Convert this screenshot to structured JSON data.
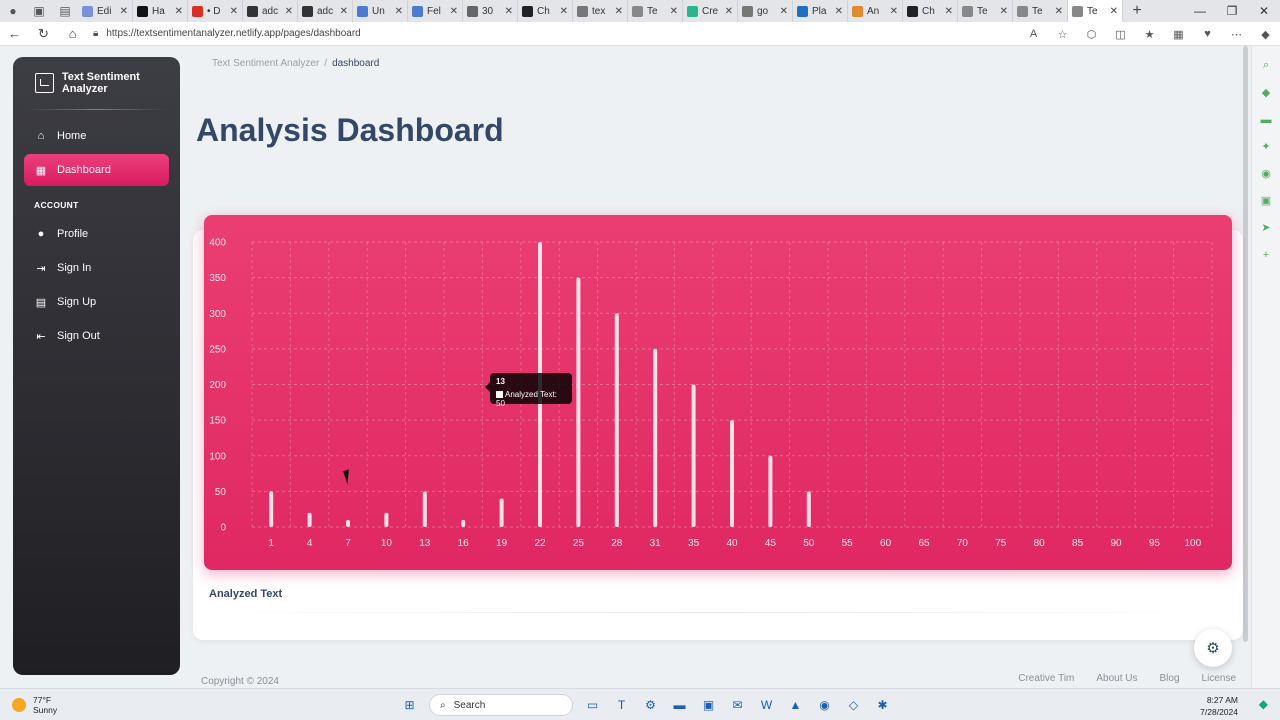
{
  "browser": {
    "tabs": [
      {
        "label": "Edi",
        "color": "#7a8fd6"
      },
      {
        "label": "Ha",
        "color": "#111111"
      },
      {
        "label": "• D",
        "color": "#d93025"
      },
      {
        "label": "adc",
        "color": "#333333"
      },
      {
        "label": "adc",
        "color": "#333333"
      },
      {
        "label": "Un",
        "color": "#4a7bd1"
      },
      {
        "label": "Fel",
        "color": "#4a7bd1"
      },
      {
        "label": "30",
        "color": "#666666"
      },
      {
        "label": "Ch",
        "color": "#222222"
      },
      {
        "label": "tex",
        "color": "#777777"
      },
      {
        "label": "Te",
        "color": "#888888"
      },
      {
        "label": "Cre",
        "color": "#2bb58f"
      },
      {
        "label": "go",
        "color": "#777777"
      },
      {
        "label": "Pla",
        "color": "#1f6fbf"
      },
      {
        "label": "An",
        "color": "#e08a2e"
      },
      {
        "label": "Ch",
        "color": "#222222"
      },
      {
        "label": "Te",
        "color": "#888888"
      },
      {
        "label": "Te",
        "color": "#888888"
      },
      {
        "label": "Te",
        "color": "#888888",
        "active": true
      }
    ],
    "url": "https://textsentimentanalyzer.netlify.app/pages/dashboard"
  },
  "sidebar": {
    "brand": "Text Sentiment Analyzer",
    "items": [
      {
        "label": "Home",
        "icon": "home-icon"
      },
      {
        "label": "Dashboard",
        "icon": "dashboard-icon",
        "active": true
      }
    ],
    "section": "ACCOUNT",
    "account_items": [
      {
        "label": "Profile",
        "icon": "person-icon"
      },
      {
        "label": "Sign In",
        "icon": "login-icon"
      },
      {
        "label": "Sign Up",
        "icon": "assignment-icon"
      },
      {
        "label": "Sign Out",
        "icon": "logout-icon"
      }
    ]
  },
  "breadcrumb": {
    "root": "Text Sentiment Analyzer",
    "sep": "/",
    "current": "dashboard"
  },
  "page_title": "Analysis Dashboard",
  "card": {
    "title": "Analyzed Text"
  },
  "tooltip": {
    "title": "13",
    "text": "Analyzed Text: 50"
  },
  "chart_data": {
    "type": "bar",
    "categories": [
      "1",
      "4",
      "7",
      "10",
      "13",
      "16",
      "19",
      "22",
      "25",
      "28",
      "31",
      "35",
      "40",
      "45",
      "50",
      "55",
      "60",
      "65",
      "70",
      "75",
      "80",
      "85",
      "90",
      "95",
      "100"
    ],
    "series": [
      {
        "name": "Analyzed Text",
        "values": [
          50,
          20,
          10,
          20,
          50,
          10,
          40,
          400,
          350,
          300,
          250,
          200,
          150,
          100,
          50,
          0,
          0,
          0,
          0,
          0,
          0,
          0,
          0,
          0,
          0
        ]
      }
    ],
    "yticks": [
      0,
      50,
      100,
      150,
      200,
      250,
      300,
      350,
      400
    ],
    "ylim": [
      0,
      400
    ],
    "colors": {
      "background": "#e91e63",
      "bar": "#ffffff"
    }
  },
  "footer": {
    "copyright": "Copyright © 2024",
    "links": [
      "Creative Tim",
      "About Us",
      "Blog",
      "License"
    ]
  },
  "taskbar": {
    "temp": "77°F",
    "weather": "Sunny",
    "search_placeholder": "Search",
    "time": "8:27 AM",
    "date": "7/28/2024"
  }
}
